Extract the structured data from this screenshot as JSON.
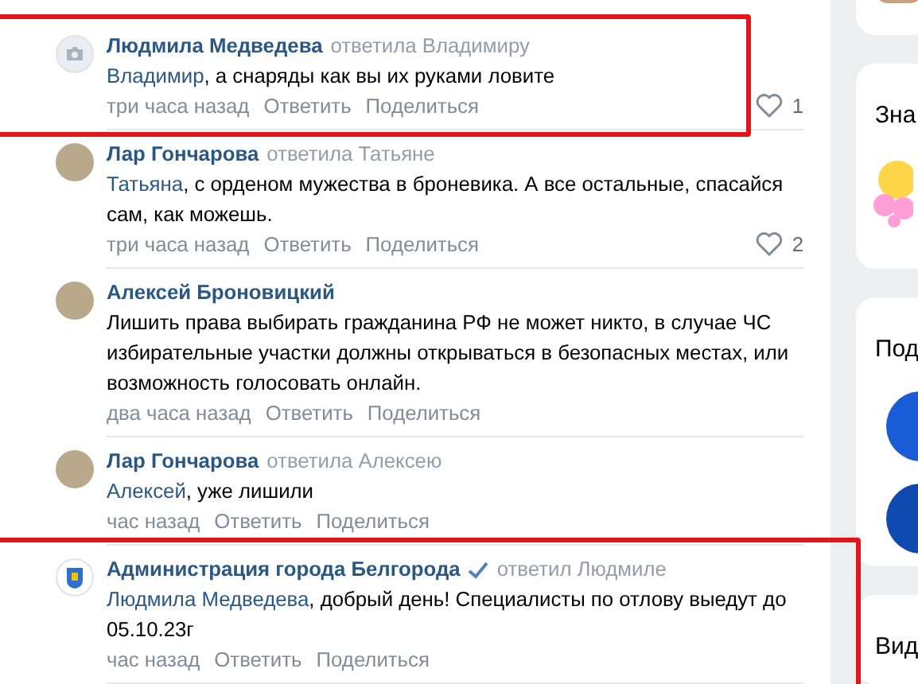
{
  "comments": [
    {
      "author": "Людмила Медведева",
      "reply_to": "ответила Владимиру",
      "verified": false,
      "kind": "camera",
      "highlighted": true,
      "mention": "Владимир",
      "text": ", а снаряды как вы их руками ловите",
      "time": "три часа назад",
      "reply": "Ответить",
      "share": "Поделиться",
      "likes": "1"
    },
    {
      "author": "Лар Гончарова",
      "reply_to": "ответила Татьяне",
      "verified": false,
      "kind": "photo",
      "highlighted": false,
      "mention": "Татьяна",
      "text": ", с орденом мужества в броневика. А все остальные, спасайся сам, как можешь.",
      "time": "три часа назад",
      "reply": "Ответить",
      "share": "Поделиться",
      "likes": "2"
    },
    {
      "author": "Алексей Броновицкий",
      "verified": false,
      "kind": "photo",
      "highlighted": false,
      "text": "Лишить права выбирать гражданина РФ не может никто, в случае ЧС избирательные участки должны открываться в безопасных местах, или возможность голосовать онлайн.",
      "time": "два часа назад",
      "reply": "Ответить",
      "share": "Поделиться"
    },
    {
      "author": "Лар Гончарова",
      "reply_to": "ответила Алексею",
      "verified": false,
      "kind": "photo",
      "highlighted": false,
      "mention": "Алексей",
      "text": ", уже лишили",
      "time": "час назад",
      "reply": "Ответить",
      "share": "Поделиться"
    },
    {
      "author": "Администрация города Белгорода",
      "reply_to": "ответил Людмиле",
      "verified": true,
      "kind": "emblem",
      "highlighted": true,
      "mention": "Людмила Медведева",
      "text": ", добрый день! Специалисты по отлову выедут до 05.10.23г",
      "time": "час назад",
      "reply": "Ответить",
      "share": "Поделиться"
    }
  ],
  "sidebar": {
    "cards": [
      {
        "kind": "image"
      },
      {
        "kind": "sticker",
        "title": "Зна"
      },
      {
        "kind": "groups",
        "title": "Под"
      },
      {
        "kind": "title",
        "title": "Вид"
      }
    ]
  }
}
